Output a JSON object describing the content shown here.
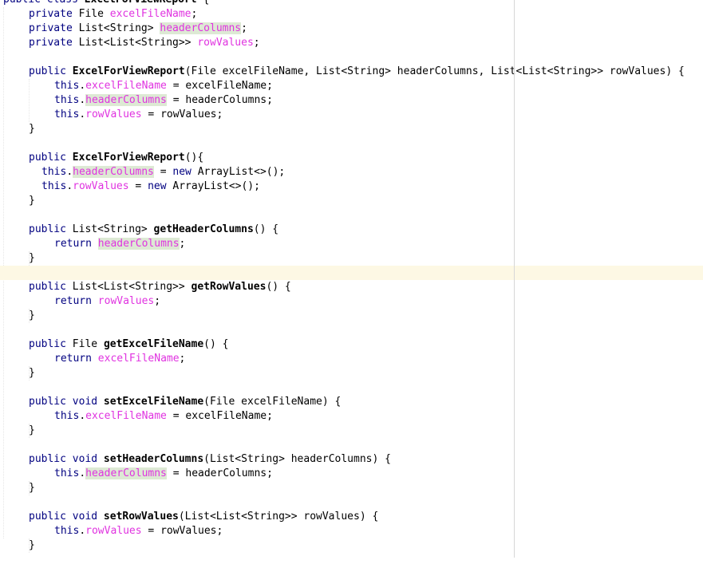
{
  "editor": {
    "language": "java",
    "current_line": 19,
    "theme": {
      "background": "#ffffff",
      "keyword": "#000080",
      "field": "#e033e0",
      "plain": "#000000",
      "usage_highlight": "#dde9d4",
      "current_line_background": "#fdf8e4",
      "right_margin_line": "#d7d7d7"
    },
    "lines": [
      {
        "indent": 0,
        "tokens": [
          {
            "t": "public class ",
            "c": "kw"
          },
          {
            "t": "ExcelForViewReport",
            "c": "bold"
          },
          {
            "t": " {"
          }
        ]
      },
      {
        "indent": 1,
        "tokens": [
          {
            "t": "private ",
            "c": "kw"
          },
          {
            "t": "File "
          },
          {
            "t": "excelFileName",
            "c": "fld"
          },
          {
            "t": ";"
          }
        ]
      },
      {
        "indent": 1,
        "tokens": [
          {
            "t": "private ",
            "c": "kw"
          },
          {
            "t": "List<String> "
          },
          {
            "t": "headerColumns",
            "c": "fld hl"
          },
          {
            "t": ";"
          }
        ]
      },
      {
        "indent": 1,
        "tokens": [
          {
            "t": "private ",
            "c": "kw"
          },
          {
            "t": "List<List<String>> "
          },
          {
            "t": "rowValues",
            "c": "fld"
          },
          {
            "t": ";"
          }
        ]
      },
      {
        "indent": 0,
        "tokens": []
      },
      {
        "indent": 1,
        "tokens": [
          {
            "t": "public ",
            "c": "kw"
          },
          {
            "t": "ExcelForViewReport",
            "c": "bold"
          },
          {
            "t": "(File excelFileName, List<String> headerColumns, List<List<String>> rowValues) {"
          }
        ]
      },
      {
        "indent": 2,
        "tokens": [
          {
            "t": "this",
            "c": "kw"
          },
          {
            "t": "."
          },
          {
            "t": "excelFileName",
            "c": "fld"
          },
          {
            "t": " = excelFileName;"
          }
        ]
      },
      {
        "indent": 2,
        "tokens": [
          {
            "t": "this",
            "c": "kw"
          },
          {
            "t": "."
          },
          {
            "t": "headerColumns",
            "c": "fld hl"
          },
          {
            "t": " = headerColumns;"
          }
        ]
      },
      {
        "indent": 2,
        "tokens": [
          {
            "t": "this",
            "c": "kw"
          },
          {
            "t": "."
          },
          {
            "t": "rowValues",
            "c": "fld"
          },
          {
            "t": " = rowValues;"
          }
        ]
      },
      {
        "indent": 1,
        "tokens": [
          {
            "t": "}"
          }
        ]
      },
      {
        "indent": 0,
        "tokens": []
      },
      {
        "indent": 1,
        "tokens": [
          {
            "t": "public ",
            "c": "kw"
          },
          {
            "t": "ExcelForViewReport",
            "c": "bold"
          },
          {
            "t": "(){"
          }
        ]
      },
      {
        "indent": 1,
        "extra": 2,
        "tokens": [
          {
            "t": "this",
            "c": "kw"
          },
          {
            "t": "."
          },
          {
            "t": "headerColumns",
            "c": "fld hl"
          },
          {
            "t": " = "
          },
          {
            "t": "new ",
            "c": "kw"
          },
          {
            "t": "ArrayList<>();"
          }
        ]
      },
      {
        "indent": 1,
        "extra": 2,
        "tokens": [
          {
            "t": "this",
            "c": "kw"
          },
          {
            "t": "."
          },
          {
            "t": "rowValues",
            "c": "fld"
          },
          {
            "t": " = "
          },
          {
            "t": "new ",
            "c": "kw"
          },
          {
            "t": "ArrayList<>();"
          }
        ]
      },
      {
        "indent": 1,
        "tokens": [
          {
            "t": "}"
          }
        ]
      },
      {
        "indent": 0,
        "tokens": []
      },
      {
        "indent": 1,
        "tokens": [
          {
            "t": "public ",
            "c": "kw"
          },
          {
            "t": "List<String> "
          },
          {
            "t": "getHeaderColumns",
            "c": "bold"
          },
          {
            "t": "() {"
          }
        ]
      },
      {
        "indent": 2,
        "tokens": [
          {
            "t": "return ",
            "c": "kw"
          },
          {
            "t": "headerColumns",
            "c": "fld hl"
          },
          {
            "t": ";"
          }
        ]
      },
      {
        "indent": 1,
        "tokens": [
          {
            "t": "}"
          }
        ]
      },
      {
        "indent": 0,
        "tokens": []
      },
      {
        "indent": 1,
        "tokens": [
          {
            "t": "public ",
            "c": "kw"
          },
          {
            "t": "List<List<String>> "
          },
          {
            "t": "getRowValues",
            "c": "bold"
          },
          {
            "t": "() {"
          }
        ]
      },
      {
        "indent": 2,
        "tokens": [
          {
            "t": "return ",
            "c": "kw"
          },
          {
            "t": "rowValues",
            "c": "fld"
          },
          {
            "t": ";"
          }
        ]
      },
      {
        "indent": 1,
        "tokens": [
          {
            "t": "}"
          }
        ]
      },
      {
        "indent": 0,
        "tokens": []
      },
      {
        "indent": 1,
        "tokens": [
          {
            "t": "public ",
            "c": "kw"
          },
          {
            "t": "File "
          },
          {
            "t": "getExcelFileName",
            "c": "bold"
          },
          {
            "t": "() {"
          }
        ]
      },
      {
        "indent": 2,
        "tokens": [
          {
            "t": "return ",
            "c": "kw"
          },
          {
            "t": "excelFileName",
            "c": "fld"
          },
          {
            "t": ";"
          }
        ]
      },
      {
        "indent": 1,
        "tokens": [
          {
            "t": "}"
          }
        ]
      },
      {
        "indent": 0,
        "tokens": []
      },
      {
        "indent": 1,
        "tokens": [
          {
            "t": "public void ",
            "c": "kw"
          },
          {
            "t": "setExcelFileName",
            "c": "bold"
          },
          {
            "t": "(File excelFileName) {"
          }
        ]
      },
      {
        "indent": 2,
        "tokens": [
          {
            "t": "this",
            "c": "kw"
          },
          {
            "t": "."
          },
          {
            "t": "excelFileName",
            "c": "fld"
          },
          {
            "t": " = excelFileName;"
          }
        ]
      },
      {
        "indent": 1,
        "tokens": [
          {
            "t": "}"
          }
        ]
      },
      {
        "indent": 0,
        "tokens": []
      },
      {
        "indent": 1,
        "tokens": [
          {
            "t": "public void ",
            "c": "kw"
          },
          {
            "t": "setHeaderColumns",
            "c": "bold"
          },
          {
            "t": "(List<String> headerColumns) {"
          }
        ]
      },
      {
        "indent": 2,
        "tokens": [
          {
            "t": "this",
            "c": "kw"
          },
          {
            "t": "."
          },
          {
            "t": "headerColumns",
            "c": "fld hl"
          },
          {
            "t": " = headerColumns;"
          }
        ]
      },
      {
        "indent": 1,
        "tokens": [
          {
            "t": "}"
          }
        ]
      },
      {
        "indent": 0,
        "tokens": []
      },
      {
        "indent": 1,
        "tokens": [
          {
            "t": "public void ",
            "c": "kw"
          },
          {
            "t": "setRowValues",
            "c": "bold"
          },
          {
            "t": "(List<List<String>> rowValues) {"
          }
        ]
      },
      {
        "indent": 2,
        "tokens": [
          {
            "t": "this",
            "c": "kw"
          },
          {
            "t": "."
          },
          {
            "t": "rowValues",
            "c": "fld"
          },
          {
            "t": " = rowValues;"
          }
        ]
      },
      {
        "indent": 1,
        "tokens": [
          {
            "t": "}"
          }
        ]
      }
    ]
  }
}
